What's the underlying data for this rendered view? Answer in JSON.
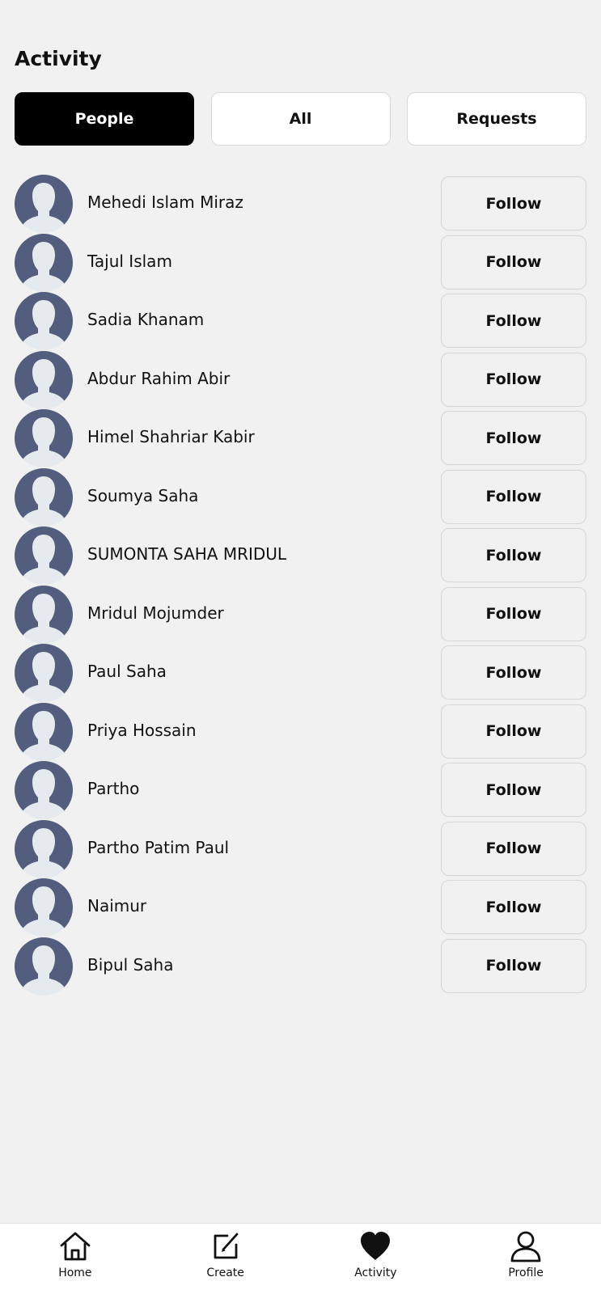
{
  "header": {
    "title": "Activity"
  },
  "tabs": [
    {
      "label": "People",
      "active": true
    },
    {
      "label": "All",
      "active": false
    },
    {
      "label": "Requests",
      "active": false
    }
  ],
  "people": [
    {
      "name": "Mehedi Islam Miraz",
      "button": "Follow"
    },
    {
      "name": "Tajul Islam",
      "button": "Follow"
    },
    {
      "name": "Sadia Khanam",
      "button": "Follow"
    },
    {
      "name": "Abdur Rahim Abir",
      "button": "Follow"
    },
    {
      "name": "Himel Shahriar Kabir",
      "button": "Follow"
    },
    {
      "name": "Soumya Saha",
      "button": "Follow"
    },
    {
      "name": "SUMONTA SAHA MRIDUL",
      "button": "Follow"
    },
    {
      "name": "Mridul Mojumder",
      "button": "Follow"
    },
    {
      "name": "Paul Saha",
      "button": "Follow"
    },
    {
      "name": "Priya Hossain",
      "button": "Follow"
    },
    {
      "name": "Partho",
      "button": "Follow"
    },
    {
      "name": "Partho Patim Paul",
      "button": "Follow"
    },
    {
      "name": "Naimur",
      "button": "Follow"
    },
    {
      "name": "Bipul Saha",
      "button": "Follow"
    }
  ],
  "nav": [
    {
      "label": "Home",
      "icon": "home-icon"
    },
    {
      "label": "Create",
      "icon": "edit-icon"
    },
    {
      "label": "Activity",
      "icon": "heart-icon"
    },
    {
      "label": "Profile",
      "icon": "user-icon"
    }
  ],
  "colors": {
    "background": "#f1f1f1",
    "active_tab": "#000000",
    "avatar_silhouette": "#535e7e",
    "avatar_bg": "#e4eaee"
  }
}
